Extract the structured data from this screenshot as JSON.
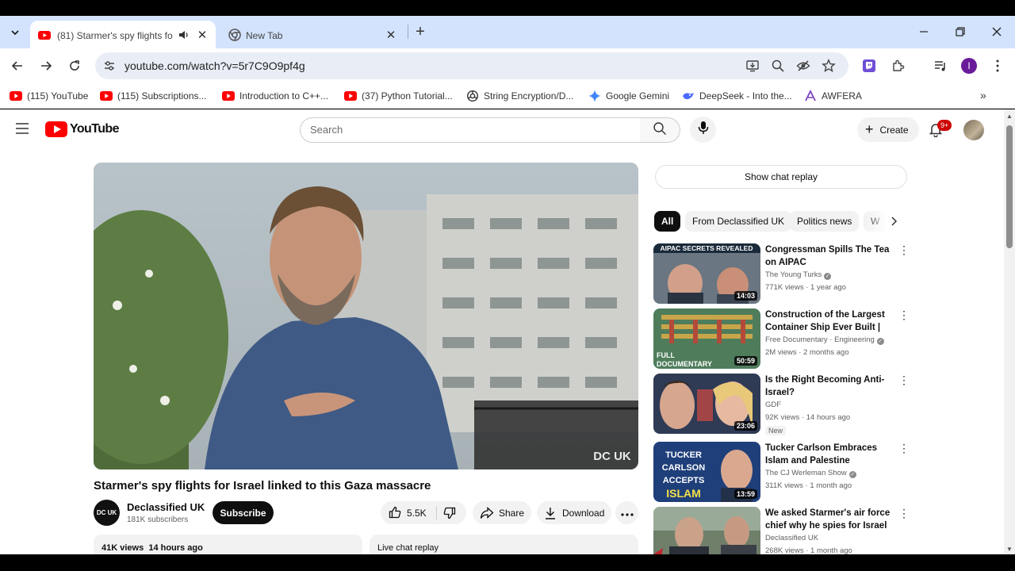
{
  "browser": {
    "tabs": [
      {
        "title": "(81) Starmer's spy flights fo",
        "active": true
      },
      {
        "title": "New Tab",
        "active": false
      }
    ],
    "url": "youtube.com/watch?v=5r7C9O9pf4g",
    "profile_initial": "I",
    "bookmarks": [
      {
        "label": "(115) YouTube",
        "icon": "youtube-icon"
      },
      {
        "label": "(115) Subscriptions...",
        "icon": "youtube-icon"
      },
      {
        "label": "Introduction to C++...",
        "icon": "youtube-icon"
      },
      {
        "label": "(37) Python Tutorial...",
        "icon": "youtube-icon"
      },
      {
        "label": "String Encryption/D...",
        "icon": "openai-icon"
      },
      {
        "label": "Google Gemini",
        "icon": "gemini-icon"
      },
      {
        "label": "DeepSeek - Into the...",
        "icon": "deepseek-icon"
      },
      {
        "label": "AWFERA",
        "icon": "awfera-icon"
      }
    ]
  },
  "youtube": {
    "logo_text": "YouTube",
    "search_placeholder": "Search",
    "create_label": "Create",
    "notifications_badge": "9+",
    "video": {
      "title": "Starmer's spy flights for Israel linked to this Gaza massacre",
      "channel": "Declassified UK",
      "channel_logo": "DC UK",
      "subscribers": "181K subscribers",
      "subscribe_label": "Subscribe",
      "likes": "5.5K",
      "share_label": "Share",
      "download_label": "Download",
      "views": "41K views",
      "age": "14 hours ago",
      "live_chat_label": "Live chat replay",
      "watermark": "DC UK"
    },
    "show_chat_replay": "Show chat replay",
    "chips": [
      "All",
      "From Declassified UK",
      "Politics news",
      "W"
    ],
    "recommendations": [
      {
        "title": "Congressman Spills The Tea on AIPAC",
        "channel": "The Young Turks",
        "verified": true,
        "meta": "771K views · 1 year ago",
        "duration": "14:03",
        "thumb_text": "AIPAC SECRETS REVEALED",
        "is_new": false
      },
      {
        "title": "Construction of the Largest Container Ship Ever Built | Me...",
        "channel": "Free Documentary · Engineering",
        "verified": true,
        "meta": "2M views · 2 months ago",
        "duration": "50:59",
        "thumb_text": "FULL DOCUMENTARY",
        "is_new": false
      },
      {
        "title": "Is the Right Becoming Anti-Israel?",
        "channel": "GDF",
        "verified": false,
        "meta": "92K views · 14 hours ago",
        "duration": "23:06",
        "thumb_text": "",
        "is_new": true,
        "new_label": "New"
      },
      {
        "title": "Tucker Carlson Embraces Islam and Palestine",
        "channel": "The CJ Werleman Show",
        "verified": true,
        "meta": "311K views · 1 month ago",
        "duration": "13:59",
        "thumb_text": "TUCKER CARLSON ACCEPTS ISLAM",
        "is_new": false
      },
      {
        "title": "We asked Starmer's air force chief why he spies for Israel",
        "channel": "Declassified UK",
        "verified": false,
        "meta": "268K views · 1 month ago",
        "duration": "",
        "thumb_text": "",
        "is_new": false
      }
    ]
  }
}
